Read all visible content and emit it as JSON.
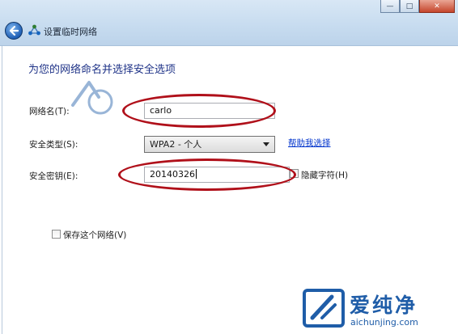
{
  "window": {
    "title": "设置临时网络",
    "controls": {
      "minimize": "—",
      "maximize": "□",
      "close": "✕"
    }
  },
  "form": {
    "heading": "为您的网络命名并选择安全选项",
    "network_name_label": "网络名(T):",
    "network_name_value": "carlo",
    "security_type_label": "安全类型(S):",
    "security_type_value": "WPA2 - 个人",
    "help_link": "帮助我选择",
    "security_key_label": "安全密钥(E):",
    "security_key_value": "20140326",
    "hide_characters_label": "隐藏字符(H)",
    "hide_characters_checked": false,
    "save_network_label": "保存这个网络(V)",
    "save_network_checked": false
  },
  "watermark": {
    "brand": "爱纯净",
    "url": "aichunjing.com",
    "accent_color": "#1f5da8"
  },
  "annotation_color": "#b0101a",
  "icons": {
    "back": "back-arrow-icon",
    "network": "network-icon",
    "dropdown": "chevron-down-icon"
  }
}
